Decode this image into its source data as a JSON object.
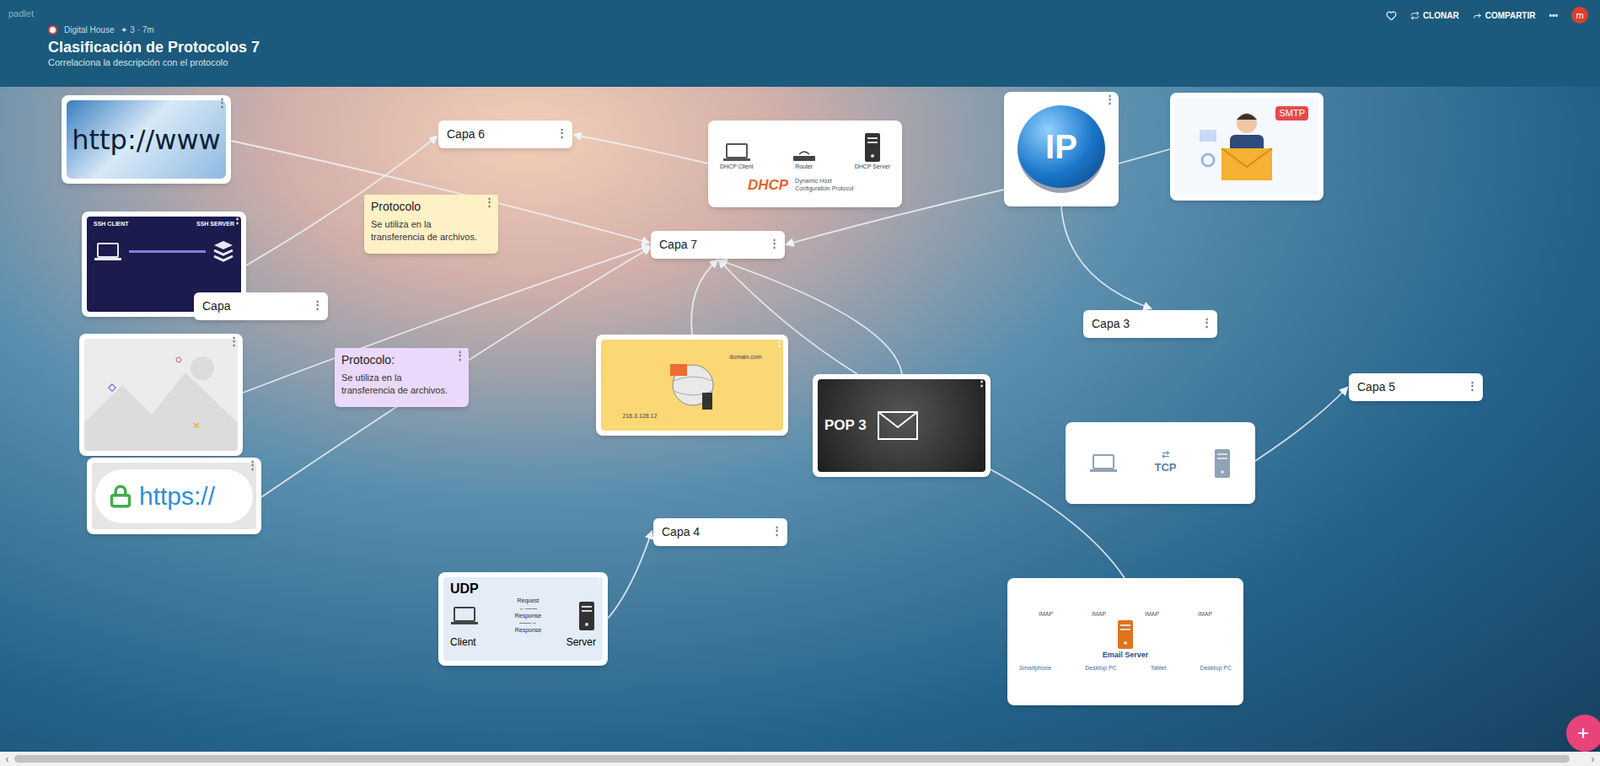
{
  "app": {
    "brand": "padlet"
  },
  "header": {
    "author": "Digital House",
    "meta": "✦ 3 · 7m",
    "title": "Clasificación de Protocolos 7",
    "subtitle": "Correlaciona la descripción con el protocolo",
    "liked": false,
    "actions": [
      {
        "label": "CLONAR"
      },
      {
        "label": "COMPARTIR"
      }
    ],
    "more": "•••",
    "avatar": "m"
  },
  "menu_glyph": "⋮",
  "labels": [
    {
      "text": "Capa 6"
    },
    {
      "text": "Capa 7"
    },
    {
      "text": "Capa"
    },
    {
      "text": "Capa 3"
    },
    {
      "text": "Capa 5"
    },
    {
      "text": "Capa 4"
    }
  ],
  "notes": [
    {
      "title": "Protocolo",
      "body": "Se utiliza en la transferencia de archivos.",
      "color": "#fff1c6"
    },
    {
      "title": "Protocolo:",
      "body": "Se utiliza en la transferencia de archivos.",
      "color": "#ead9fb"
    }
  ],
  "images": [
    {
      "kind": "http",
      "texts": [
        "http://www"
      ]
    },
    {
      "kind": "dhcp",
      "texts": [
        "DHCP Client",
        "Router",
        "DHCP Server",
        "DHCP",
        "Dynamic Host Configuration Protocol"
      ]
    },
    {
      "kind": "ip",
      "texts": [
        "IP"
      ]
    },
    {
      "kind": "smtp",
      "texts": [
        "SMTP"
      ]
    },
    {
      "kind": "ssh",
      "texts": [
        "SSH CLIENT",
        "SSH SERVER"
      ]
    },
    {
      "kind": "placeholder",
      "texts": []
    },
    {
      "kind": "dns",
      "texts": [
        "domain.com",
        "216.3.128.12"
      ]
    },
    {
      "kind": "pop3",
      "texts": [
        "POP 3"
      ]
    },
    {
      "kind": "tcp",
      "texts": [
        "TCP"
      ]
    },
    {
      "kind": "https",
      "texts": [
        "https://"
      ]
    },
    {
      "kind": "udp",
      "texts": [
        "UDP",
        "Request",
        "Response",
        "Response",
        "Client",
        "Server"
      ]
    },
    {
      "kind": "email",
      "texts": [
        "IMAP",
        "IMAP",
        "IMAP",
        "IMAP",
        "Email Server",
        "Smartphone",
        "Desktop PC",
        "Tablet",
        "Desktop PC"
      ]
    }
  ],
  "add_button": "+",
  "scrollbar": {
    "left": "‹",
    "right": "›",
    "level": 0.99
  }
}
